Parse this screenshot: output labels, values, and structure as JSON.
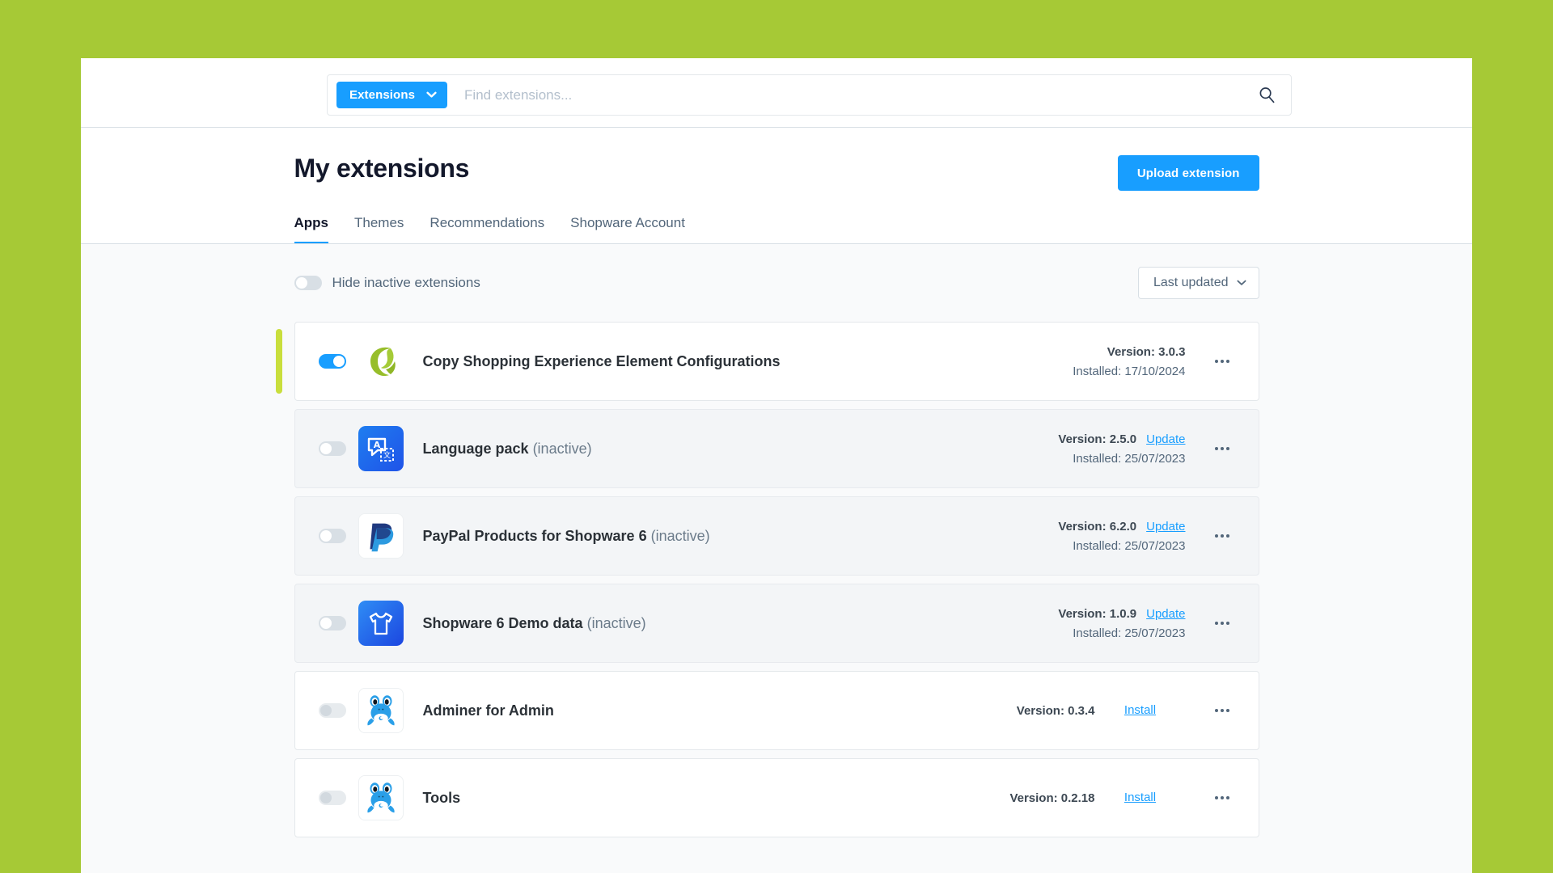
{
  "theme": {
    "page_background": "#a6c936",
    "accent_blue": "#189eff",
    "accent_green": "#c9de3c",
    "panel_background": "#ffffff",
    "content_background": "#f9fafb"
  },
  "search": {
    "scope_label": "Extensions",
    "scope_chevron_icon": "chevron-down-icon",
    "placeholder": "Find extensions...",
    "value": "",
    "search_icon": "search-icon"
  },
  "header": {
    "title": "My extensions",
    "upload_button": "Upload extension"
  },
  "tabs": [
    {
      "label": "Apps",
      "active": true
    },
    {
      "label": "Themes",
      "active": false
    },
    {
      "label": "Recommendations",
      "active": false
    },
    {
      "label": "Shopware Account",
      "active": false
    }
  ],
  "filters": {
    "hide_inactive_label": "Hide inactive extensions",
    "hide_inactive_on": false,
    "sort_label": "Last updated",
    "sort_chevron_icon": "chevron-down-icon"
  },
  "extensions": [
    {
      "name": "Copy Shopping Experience Element Configurations",
      "state_suffix": "",
      "active": true,
      "toggle_disabled": false,
      "highlighted": true,
      "icon": "copy-shopping-experience-logo",
      "version_label": "Version: 3.0.3",
      "update_label": "",
      "installed_label": "Installed: 17/10/2024",
      "install_label": "",
      "context_menu_icon": "ellipsis-icon"
    },
    {
      "name": "Language pack",
      "state_suffix": "(inactive)",
      "active": false,
      "toggle_disabled": false,
      "highlighted": false,
      "icon": "language-pack-logo",
      "version_label": "Version: 2.5.0",
      "update_label": "Update",
      "installed_label": "Installed: 25/07/2023",
      "install_label": "",
      "context_menu_icon": "ellipsis-icon"
    },
    {
      "name": "PayPal Products for Shopware 6",
      "state_suffix": "(inactive)",
      "active": false,
      "toggle_disabled": false,
      "highlighted": false,
      "icon": "paypal-logo",
      "version_label": "Version: 6.2.0",
      "update_label": "Update",
      "installed_label": "Installed: 25/07/2023",
      "install_label": "",
      "context_menu_icon": "ellipsis-icon"
    },
    {
      "name": "Shopware 6 Demo data",
      "state_suffix": "(inactive)",
      "active": false,
      "toggle_disabled": false,
      "highlighted": false,
      "icon": "demo-data-tshirt-logo",
      "version_label": "Version: 1.0.9",
      "update_label": "Update",
      "installed_label": "Installed: 25/07/2023",
      "install_label": "",
      "context_menu_icon": "ellipsis-icon"
    },
    {
      "name": "Adminer for Admin",
      "state_suffix": "",
      "active": false,
      "toggle_disabled": true,
      "highlighted": false,
      "icon": "frog-logo",
      "version_label": "Version: 0.3.4",
      "update_label": "",
      "installed_label": "",
      "install_label": "Install",
      "context_menu_icon": "ellipsis-icon"
    },
    {
      "name": "Tools",
      "state_suffix": "",
      "active": false,
      "toggle_disabled": true,
      "highlighted": false,
      "icon": "frog-logo",
      "version_label": "Version: 0.2.18",
      "update_label": "",
      "installed_label": "",
      "install_label": "Install",
      "context_menu_icon": "ellipsis-icon"
    }
  ]
}
